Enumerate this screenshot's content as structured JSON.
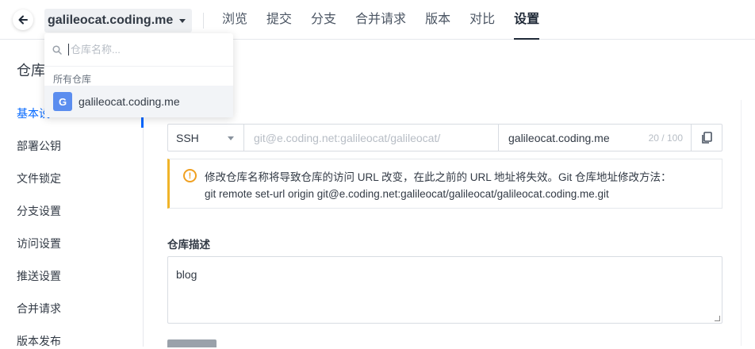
{
  "header": {
    "repo_name": "galileocat.coding.me",
    "tabs": [
      {
        "label": "浏览"
      },
      {
        "label": "提交"
      },
      {
        "label": "分支"
      },
      {
        "label": "合并请求"
      },
      {
        "label": "版本"
      },
      {
        "label": "对比"
      },
      {
        "label": "设置"
      }
    ],
    "active_tab": "设置"
  },
  "sidebar": {
    "title": "仓库",
    "items": [
      {
        "label": "基本设"
      },
      {
        "label": "部署公钥"
      },
      {
        "label": "文件锁定"
      },
      {
        "label": "分支设置"
      },
      {
        "label": "访问设置"
      },
      {
        "label": "推送设置"
      },
      {
        "label": "合并请求"
      },
      {
        "label": "版本发布"
      }
    ]
  },
  "dropdown": {
    "search_placeholder": "仓库名称...",
    "group_label": "所有仓库",
    "item_avatar": "G",
    "item_label": "galileocat.coding.me"
  },
  "main": {
    "protocol": "SSH",
    "url_prefix": "git@e.coding.net:galileocat/galileocat/",
    "repo_name_value": "galileocat.coding.me",
    "name_counter": "20 / 100",
    "warning_line1": "修改仓库名称将导致仓库的访问 URL 改变，在此之前的 URL 地址将失效。Git 仓库地址修改方法：",
    "warning_line2": "git remote set-url origin git@e.coding.net:galileocat/galileocat/galileocat.coding.me.git",
    "desc_label": "仓库描述",
    "desc_value": "blog"
  },
  "colors": {
    "accent": "#0066ff",
    "warning": "#f0a020"
  }
}
